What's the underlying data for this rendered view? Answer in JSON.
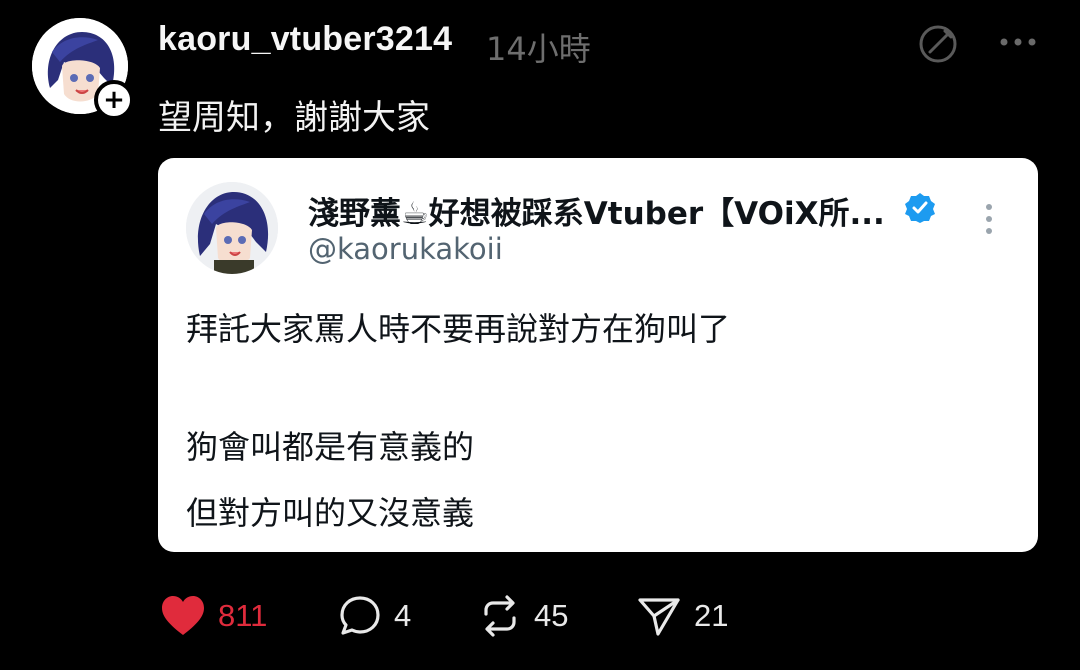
{
  "post": {
    "username": "kaoru_vtuber3214",
    "time": "14小時",
    "caption": "望周知，謝謝大家"
  },
  "embed": {
    "display_name": "淺野薰☕好想被踩系Vtuber【VOiX所...",
    "handle": "@kaorukakoii",
    "lines": [
      "拜託大家罵人時不要再說對方在狗叫了",
      "狗會叫都是有意義的",
      "但對方叫的又沒意義"
    ]
  },
  "actions": {
    "likes": "811",
    "replies": "4",
    "reposts": "45",
    "shares": "21"
  },
  "colors": {
    "background": "#000000",
    "like": "#e02b3c",
    "verified": "#1d9bf0",
    "card": "#ffffff"
  }
}
